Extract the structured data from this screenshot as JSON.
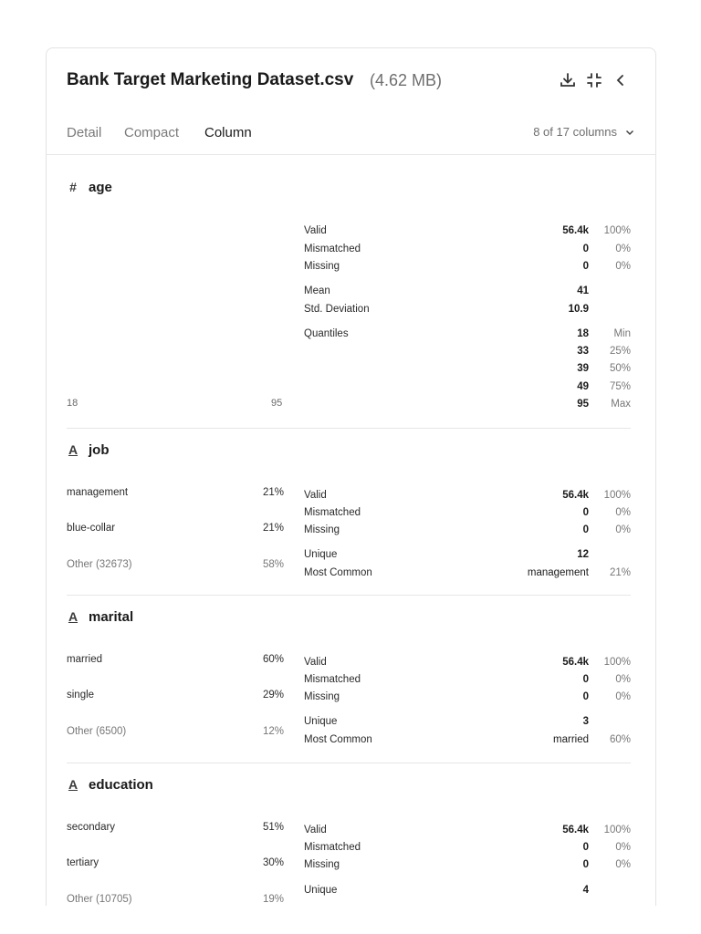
{
  "header": {
    "title": "Bank Target Marketing Dataset.csv",
    "size": "(4.62 MB)",
    "icons": [
      "download-icon",
      "fullscreen-icon",
      "collapse-icon"
    ]
  },
  "tabs": {
    "detail": "Detail",
    "compact": "Compact",
    "column": "Column",
    "active": "Column"
  },
  "columns_selector": {
    "label": "8 of 17 columns"
  },
  "sections": {
    "age": {
      "name": "age",
      "type_icon": "#",
      "axis_min": "18",
      "axis_max": "95",
      "stats": {
        "valid": {
          "k": "Valid",
          "v": "56.4k",
          "p": "100%"
        },
        "mismatched": {
          "k": "Mismatched",
          "v": "0",
          "p": "0%"
        },
        "missing": {
          "k": "Missing",
          "v": "0",
          "p": "0%"
        },
        "mean": {
          "k": "Mean",
          "v": "41"
        },
        "std": {
          "k": "Std. Deviation",
          "v": "10.9"
        },
        "quantiles": {
          "k": "Quantiles"
        },
        "q_min": {
          "v": "18",
          "p": "Min"
        },
        "q_25": {
          "v": "33",
          "p": "25%"
        },
        "q_50": {
          "v": "39",
          "p": "50%"
        },
        "q_75": {
          "v": "49",
          "p": "75%"
        },
        "q_max": {
          "v": "95",
          "p": "Max"
        }
      }
    },
    "job": {
      "name": "job",
      "type_icon": "A",
      "dist": [
        {
          "label": "management",
          "pct": "21%"
        },
        {
          "label": "blue-collar",
          "pct": "21%"
        },
        {
          "label": "Other (32673)",
          "pct": "58%"
        }
      ],
      "stats": {
        "valid": {
          "k": "Valid",
          "v": "56.4k",
          "p": "100%"
        },
        "mismatched": {
          "k": "Mismatched",
          "v": "0",
          "p": "0%"
        },
        "missing": {
          "k": "Missing",
          "v": "0",
          "p": "0%"
        },
        "unique": {
          "k": "Unique",
          "v": "12"
        },
        "common": {
          "k": "Most Common",
          "v": "management",
          "p": "21%"
        }
      }
    },
    "marital": {
      "name": "marital",
      "type_icon": "A",
      "dist": [
        {
          "label": "married",
          "pct": "60%"
        },
        {
          "label": "single",
          "pct": "29%"
        },
        {
          "label": "Other (6500)",
          "pct": "12%"
        }
      ],
      "stats": {
        "valid": {
          "k": "Valid",
          "v": "56.4k",
          "p": "100%"
        },
        "mismatched": {
          "k": "Mismatched",
          "v": "0",
          "p": "0%"
        },
        "missing": {
          "k": "Missing",
          "v": "0",
          "p": "0%"
        },
        "unique": {
          "k": "Unique",
          "v": "3"
        },
        "common": {
          "k": "Most Common",
          "v": "married",
          "p": "60%"
        }
      }
    },
    "education": {
      "name": "education",
      "type_icon": "A",
      "dist": [
        {
          "label": "secondary",
          "pct": "51%"
        },
        {
          "label": "tertiary",
          "pct": "30%"
        },
        {
          "label": "Other (10705)",
          "pct": "19%"
        }
      ],
      "stats": {
        "valid": {
          "k": "Valid",
          "v": "56.4k",
          "p": "100%"
        },
        "mismatched": {
          "k": "Mismatched",
          "v": "0",
          "p": "0%"
        },
        "missing": {
          "k": "Missing",
          "v": "0",
          "p": "0%"
        },
        "unique": {
          "k": "Unique",
          "v": "4"
        }
      }
    }
  }
}
